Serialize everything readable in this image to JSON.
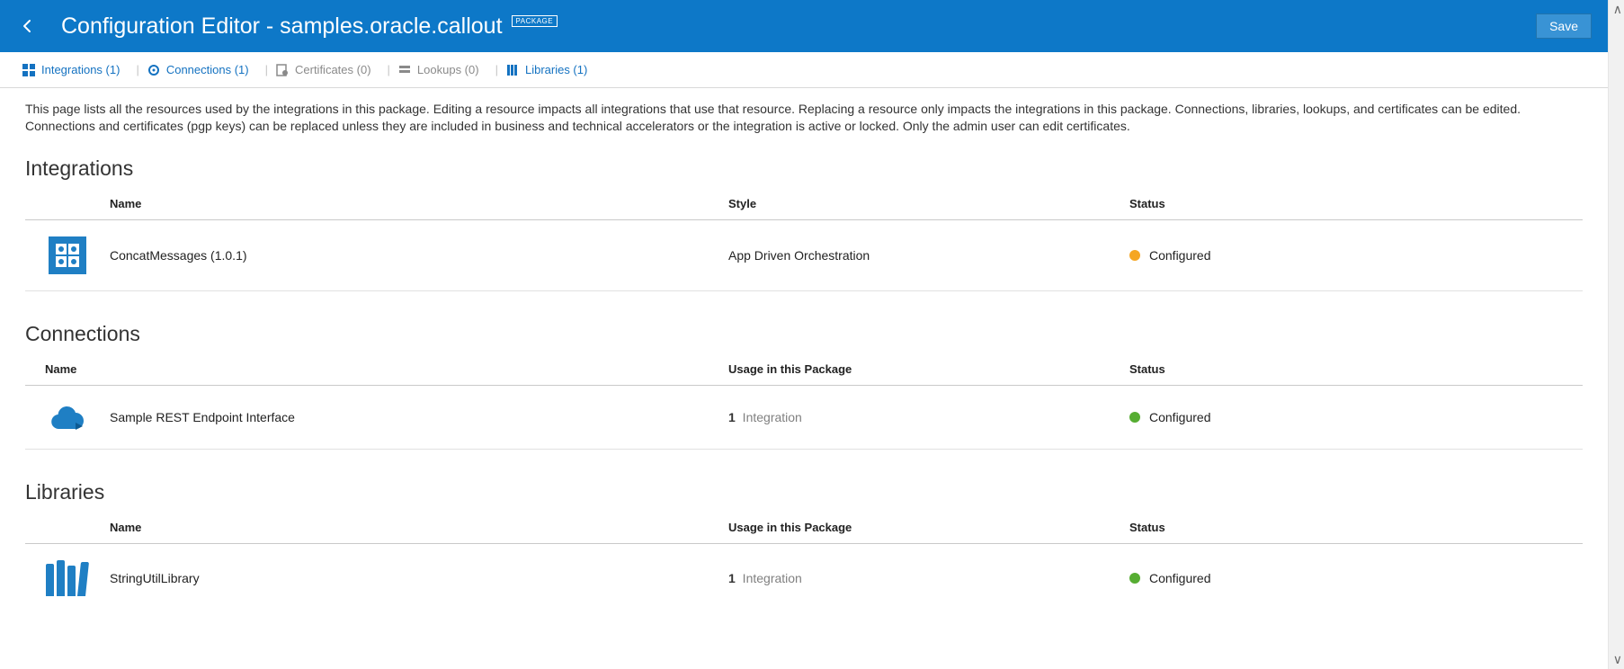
{
  "header": {
    "title": "Configuration Editor - samples.oracle.callout",
    "badge": "PACKAGE",
    "save_label": "Save"
  },
  "tabs": [
    {
      "label": "Integrations (1)"
    },
    {
      "label": "Connections (1)"
    },
    {
      "label": "Certificates (0)"
    },
    {
      "label": "Lookups (0)"
    },
    {
      "label": "Libraries (1)"
    }
  ],
  "description": "This page lists all the resources used by the integrations in this package. Editing a resource impacts all integrations that use that resource. Replacing a resource only impacts the integrations in this package. Connections, libraries, lookups, and certificates can be edited. Connections and certificates (pgp keys) can be replaced unless they are included in business and technical accelerators or the integration is active or locked. Only the admin user can edit certificates.",
  "sections": {
    "integrations": {
      "heading": "Integrations",
      "columns": [
        "Name",
        "Style",
        "Status"
      ],
      "rows": [
        {
          "name": "ConcatMessages (1.0.1)",
          "style": "App Driven Orchestration",
          "status": "Configured",
          "status_color": "orange"
        }
      ]
    },
    "connections": {
      "heading": "Connections",
      "columns": [
        "Name",
        "Usage in this Package",
        "Status"
      ],
      "rows": [
        {
          "name": "Sample REST Endpoint Interface",
          "usage_count": "1",
          "usage_label": " Integration",
          "status": "Configured",
          "status_color": "green"
        }
      ]
    },
    "libraries": {
      "heading": "Libraries",
      "columns": [
        "Name",
        "Usage in this Package",
        "Status"
      ],
      "rows": [
        {
          "name": "StringUtilLibrary",
          "usage_count": "1",
          "usage_label": " Integration",
          "status": "Configured",
          "status_color": "green"
        }
      ]
    }
  }
}
